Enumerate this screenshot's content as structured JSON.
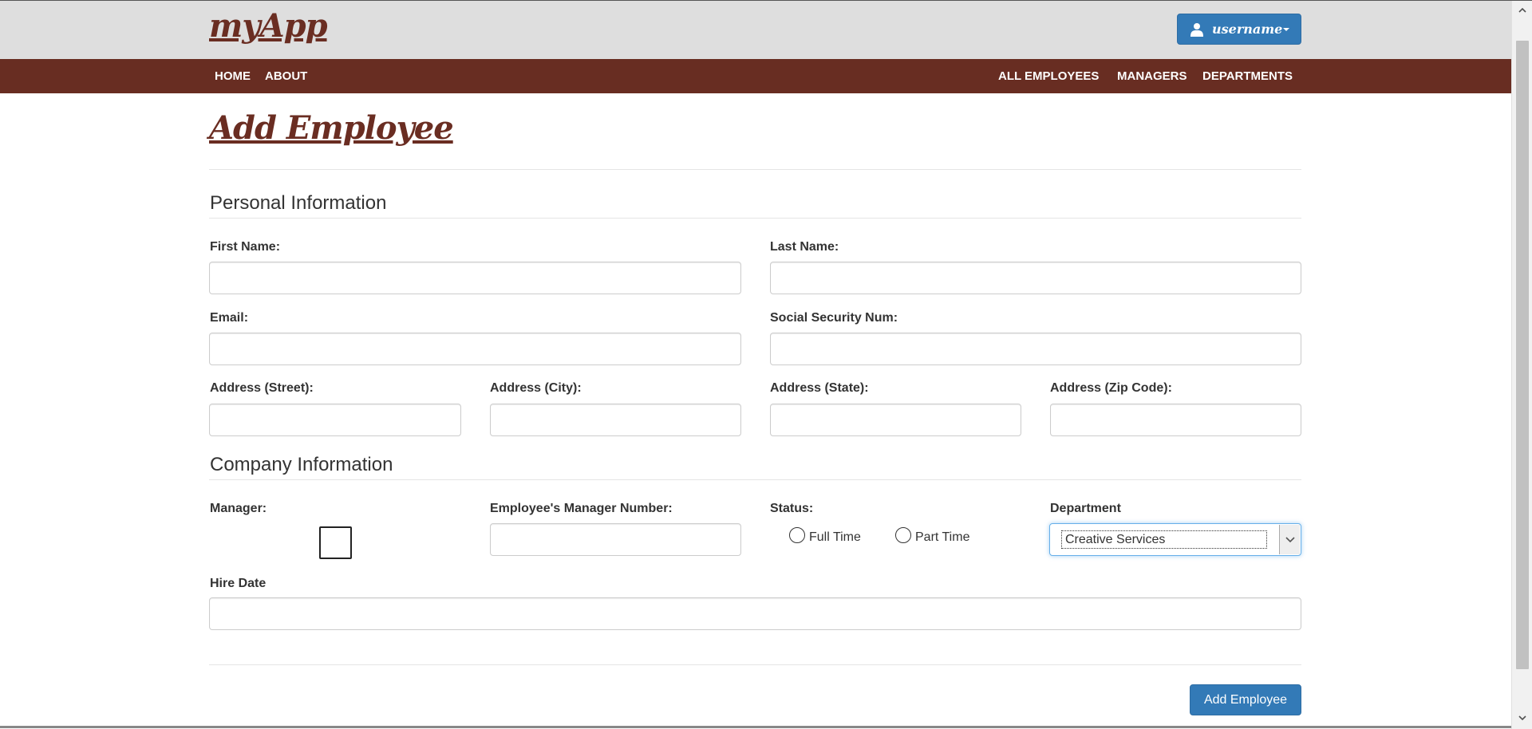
{
  "header": {
    "brand": "myApp",
    "user_menu_label": "username"
  },
  "nav": {
    "left": [
      "HOME",
      "ABOUT"
    ],
    "right": [
      "ALL EMPLOYEES",
      "MANAGERS",
      "DEPARTMENTS"
    ]
  },
  "page": {
    "title": "Add Employee"
  },
  "personal": {
    "section_title": "Personal Information",
    "first_name_label": "First Name:",
    "first_name_value": "",
    "last_name_label": "Last Name:",
    "last_name_value": "",
    "email_label": "Email:",
    "email_value": "",
    "ssn_label": "Social Security Num:",
    "ssn_value": "",
    "street_label": "Address (Street):",
    "street_value": "",
    "city_label": "Address (City):",
    "city_value": "",
    "state_label": "Address (State):",
    "state_value": "",
    "zip_label": "Address (Zip Code):",
    "zip_value": ""
  },
  "company": {
    "section_title": "Company Information",
    "manager_label": "Manager:",
    "manager_checked": false,
    "manager_number_label": "Employee's Manager Number:",
    "manager_number_value": "",
    "status_label": "Status:",
    "status_options": [
      "Full Time",
      "Part Time"
    ],
    "status_selected": null,
    "department_label": "Department",
    "department_selected": "Creative Services",
    "hire_date_label": "Hire Date",
    "hire_date_value": ""
  },
  "actions": {
    "submit_label": "Add Employee"
  },
  "colors": {
    "brand": "#6a2d22",
    "navbar": "#682d22",
    "header_bg": "#dedede",
    "primary_button": "#337ab7"
  },
  "icons": {
    "user": "user-icon",
    "dropdown": "caret-down-icon",
    "select_arrow": "chevron-down-icon"
  }
}
